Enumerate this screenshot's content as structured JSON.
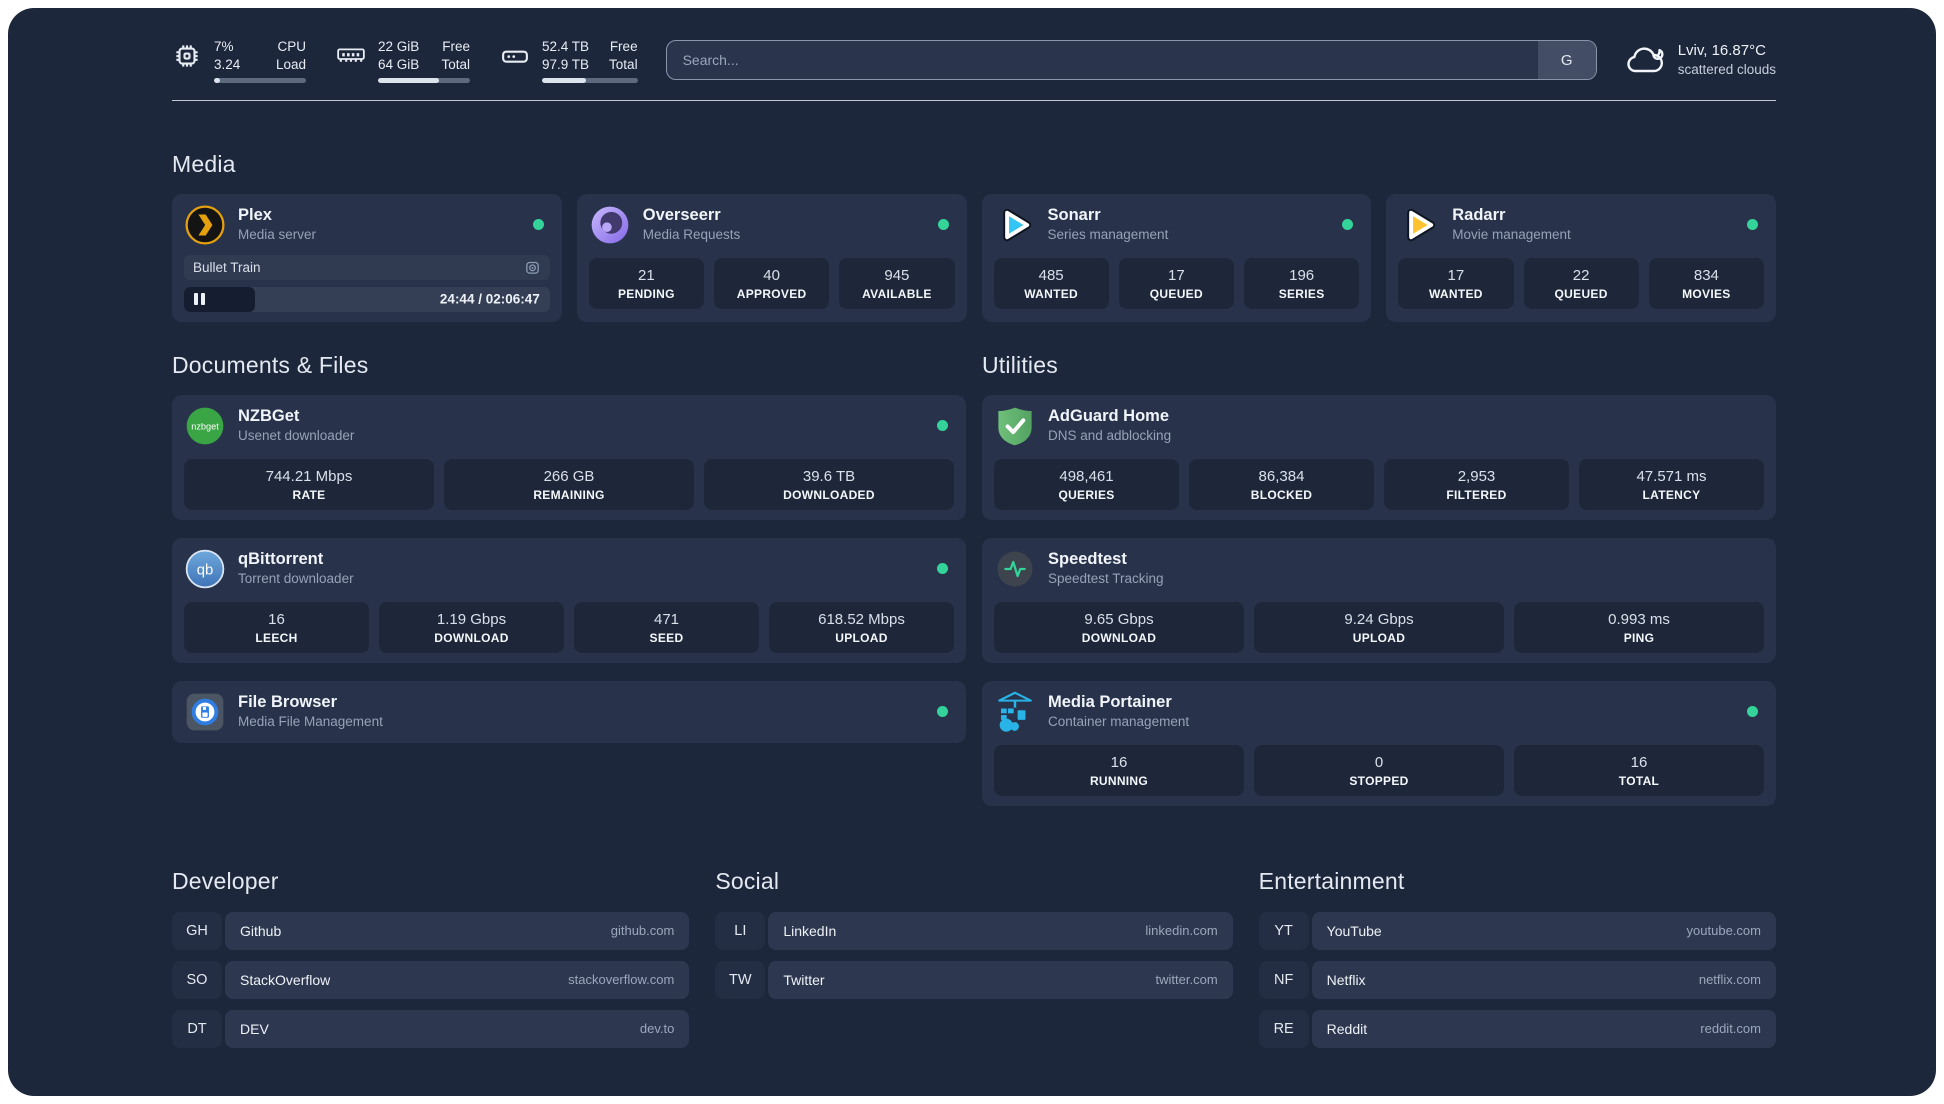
{
  "colors": {
    "status_online": "#34d399",
    "accent_blue": "#29b3e6"
  },
  "header": {
    "resources": [
      {
        "icon": "cpu-icon",
        "value_top": "7%",
        "value_bottom": "3.24",
        "label_top": "CPU",
        "label_bottom": "Load",
        "progress_pct": 7
      },
      {
        "icon": "memory-icon",
        "value_top": "22 GiB",
        "value_bottom": "64 GiB",
        "label_top": "Free",
        "label_bottom": "Total",
        "progress_pct": 66
      },
      {
        "icon": "disk-icon",
        "value_top": "52.4 TB",
        "value_bottom": "97.9 TB",
        "label_top": "Free",
        "label_bottom": "Total",
        "progress_pct": 46
      }
    ],
    "search": {
      "placeholder": "Search...",
      "engine_button": "G"
    },
    "weather": {
      "icon": "cloud-icon",
      "location": "Lviv, 16.87°C",
      "condition": "scattered clouds"
    }
  },
  "sections": {
    "media": {
      "title": "Media",
      "cards": [
        {
          "icon": "plex-icon",
          "title": "Plex",
          "subtitle": "Media server",
          "online": true,
          "now_playing": {
            "title": "Bullet Train",
            "time": "24:44 / 02:06:47",
            "progress_pct": 19.5
          }
        },
        {
          "icon": "overseerr-icon",
          "title": "Overseerr",
          "subtitle": "Media Requests",
          "online": true,
          "stats": [
            {
              "value": "21",
              "label": "PENDING"
            },
            {
              "value": "40",
              "label": "APPROVED"
            },
            {
              "value": "945",
              "label": "AVAILABLE"
            }
          ]
        },
        {
          "icon": "sonarr-icon",
          "title": "Sonarr",
          "subtitle": "Series management",
          "online": true,
          "stats": [
            {
              "value": "485",
              "label": "WANTED"
            },
            {
              "value": "17",
              "label": "QUEUED"
            },
            {
              "value": "196",
              "label": "SERIES"
            }
          ]
        },
        {
          "icon": "radarr-icon",
          "title": "Radarr",
          "subtitle": "Movie management",
          "online": true,
          "stats": [
            {
              "value": "17",
              "label": "WANTED"
            },
            {
              "value": "22",
              "label": "QUEUED"
            },
            {
              "value": "834",
              "label": "MOVIES"
            }
          ]
        }
      ]
    },
    "documents": {
      "title": "Documents & Files",
      "cards": [
        {
          "icon": "nzbget-icon",
          "title": "NZBGet",
          "subtitle": "Usenet downloader",
          "online": true,
          "stats": [
            {
              "value": "744.21 Mbps",
              "label": "RATE"
            },
            {
              "value": "266 GB",
              "label": "REMAINING"
            },
            {
              "value": "39.6 TB",
              "label": "DOWNLOADED"
            }
          ]
        },
        {
          "icon": "qbittorrent-icon",
          "title": "qBittorrent",
          "subtitle": "Torrent downloader",
          "online": true,
          "stats": [
            {
              "value": "16",
              "label": "LEECH"
            },
            {
              "value": "1.19 Gbps",
              "label": "DOWNLOAD"
            },
            {
              "value": "471",
              "label": "SEED"
            },
            {
              "value": "618.52 Mbps",
              "label": "UPLOAD"
            }
          ]
        },
        {
          "icon": "filebrowser-icon",
          "title": "File Browser",
          "subtitle": "Media File Management",
          "online": true,
          "stats": []
        }
      ]
    },
    "utilities": {
      "title": "Utilities",
      "cards": [
        {
          "icon": "adguard-icon",
          "title": "AdGuard Home",
          "subtitle": "DNS and adblocking",
          "online": false,
          "stats": [
            {
              "value": "498,461",
              "label": "QUERIES"
            },
            {
              "value": "86,384",
              "label": "BLOCKED"
            },
            {
              "value": "2,953",
              "label": "FILTERED"
            },
            {
              "value": "47.571 ms",
              "label": "LATENCY"
            }
          ]
        },
        {
          "icon": "speedtest-icon",
          "title": "Speedtest",
          "subtitle": "Speedtest Tracking",
          "online": false,
          "stats": [
            {
              "value": "9.65 Gbps",
              "label": "DOWNLOAD"
            },
            {
              "value": "9.24 Gbps",
              "label": "UPLOAD"
            },
            {
              "value": "0.993 ms",
              "label": "PING"
            }
          ]
        },
        {
          "icon": "portainer-icon",
          "title": "Media Portainer",
          "subtitle": "Container management",
          "online": true,
          "stats": [
            {
              "value": "16",
              "label": "RUNNING"
            },
            {
              "value": "0",
              "label": "STOPPED"
            },
            {
              "value": "16",
              "label": "TOTAL"
            }
          ]
        }
      ]
    }
  },
  "bookmarks": [
    {
      "title": "Developer",
      "links": [
        {
          "abbr": "GH",
          "name": "Github",
          "url": "github.com"
        },
        {
          "abbr": "SO",
          "name": "StackOverflow",
          "url": "stackoverflow.com"
        },
        {
          "abbr": "DT",
          "name": "DEV",
          "url": "dev.to"
        }
      ]
    },
    {
      "title": "Social",
      "links": [
        {
          "abbr": "LI",
          "name": "LinkedIn",
          "url": "linkedin.com"
        },
        {
          "abbr": "TW",
          "name": "Twitter",
          "url": "twitter.com"
        }
      ]
    },
    {
      "title": "Entertainment",
      "links": [
        {
          "abbr": "YT",
          "name": "YouTube",
          "url": "youtube.com"
        },
        {
          "abbr": "NF",
          "name": "Netflix",
          "url": "netflix.com"
        },
        {
          "abbr": "RE",
          "name": "Reddit",
          "url": "reddit.com"
        }
      ]
    }
  ]
}
